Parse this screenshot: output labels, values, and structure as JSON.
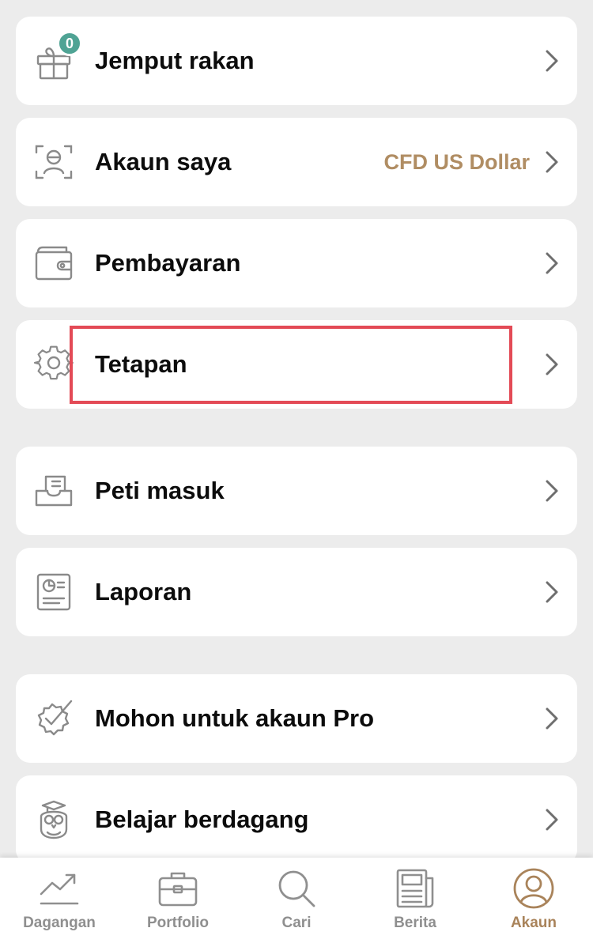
{
  "menu": {
    "invite": {
      "label": "Jemput rakan",
      "badge": "0"
    },
    "account": {
      "label": "Akaun saya",
      "value": "CFD US Dollar"
    },
    "payment": {
      "label": "Pembayaran"
    },
    "settings": {
      "label": "Tetapan"
    },
    "inbox": {
      "label": "Peti masuk"
    },
    "reports": {
      "label": "Laporan"
    },
    "pro": {
      "label": "Mohon untuk akaun Pro"
    },
    "learn": {
      "label": "Belajar berdagang"
    }
  },
  "tabbar": {
    "trading": "Dagangan",
    "portfolio": "Portfolio",
    "search": "Cari",
    "news": "Berita",
    "account": "Akaun",
    "active": "account"
  },
  "colors": {
    "accent": "#b08d63",
    "badge": "#4fa394",
    "highlight": "#e34a56",
    "icon_gray": "#8a8a8a"
  }
}
